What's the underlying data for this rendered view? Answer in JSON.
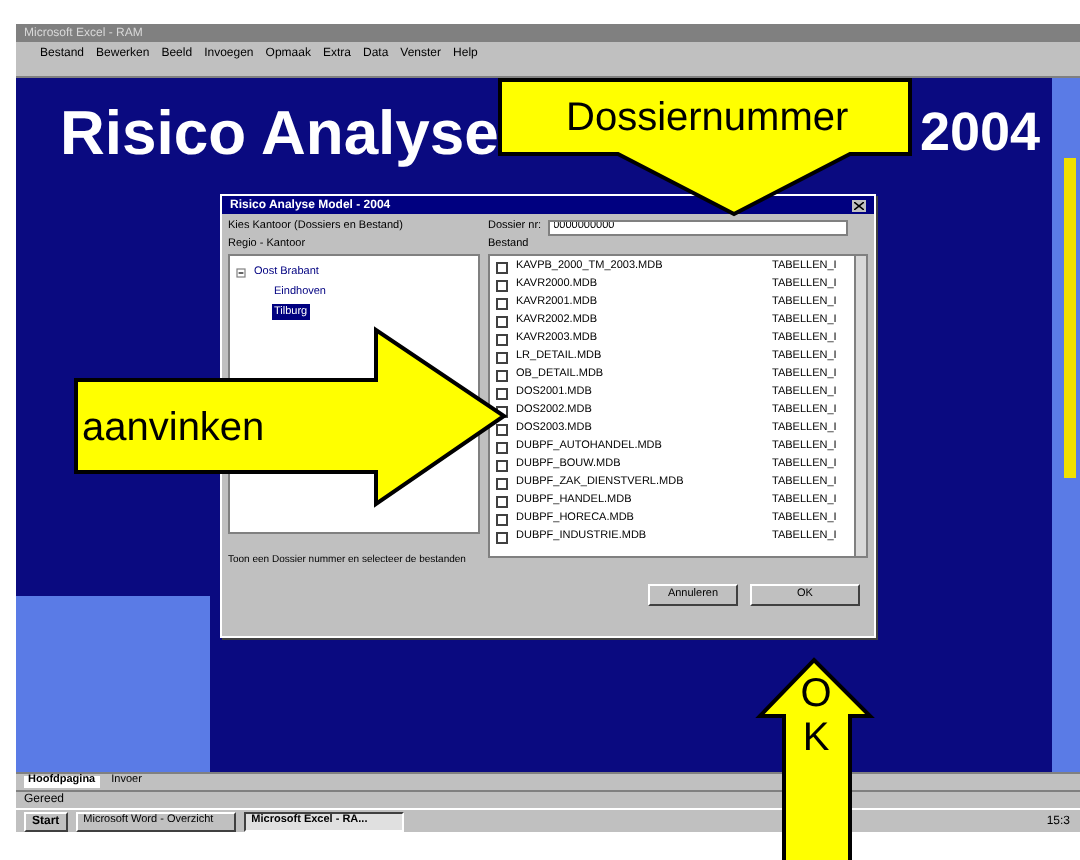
{
  "window": {
    "title": "Microsoft Excel - RAM"
  },
  "menu": [
    "Bestand",
    "Bewerken",
    "Beeld",
    "Invoegen",
    "Opmaak",
    "Extra",
    "Data",
    "Venster",
    "Help"
  ],
  "slide": {
    "title_start": "Risico Analyse",
    "title_end": "2004"
  },
  "dialog": {
    "title": "Risico Analyse Model - 2004",
    "kantoor_label": "Kies Kantoor (Dossiers en Bestand)",
    "regio_label": "Regio - Kantoor",
    "tree": [
      {
        "label": "Oost Brabant",
        "expanded": true,
        "selected": false,
        "children": [
          {
            "label": "Eindhoven",
            "selected": false
          },
          {
            "label": "Tilburg",
            "selected": true
          }
        ]
      }
    ],
    "dossier_label": "Dossier nr:",
    "dossier_value": "0000000000",
    "bestand_label": "Bestand",
    "files": [
      {
        "name": "KAVPB_2000_TM_2003.MDB",
        "type": "TABELLEN_I",
        "checked": false
      },
      {
        "name": "KAVR2000.MDB",
        "type": "TABELLEN_I",
        "checked": false
      },
      {
        "name": "KAVR2001.MDB",
        "type": "TABELLEN_I",
        "checked": false
      },
      {
        "name": "KAVR2002.MDB",
        "type": "TABELLEN_I",
        "checked": false
      },
      {
        "name": "KAVR2003.MDB",
        "type": "TABELLEN_I",
        "checked": false
      },
      {
        "name": "LR_DETAIL.MDB",
        "type": "TABELLEN_I",
        "checked": false
      },
      {
        "name": "OB_DETAIL.MDB",
        "type": "TABELLEN_I",
        "checked": false
      },
      {
        "name": "DOS2001.MDB",
        "type": "TABELLEN_I",
        "checked": false
      },
      {
        "name": "DOS2002.MDB",
        "type": "TABELLEN_I",
        "checked": false
      },
      {
        "name": "DOS2003.MDB",
        "type": "TABELLEN_I",
        "checked": false
      },
      {
        "name": "DUBPF_AUTOHANDEL.MDB",
        "type": "TABELLEN_I",
        "checked": false
      },
      {
        "name": "DUBPF_BOUW.MDB",
        "type": "TABELLEN_I",
        "checked": false
      },
      {
        "name": "DUBPF_ZAK_DIENSTVERL.MDB",
        "type": "TABELLEN_I",
        "checked": false
      },
      {
        "name": "DUBPF_HANDEL.MDB",
        "type": "TABELLEN_I",
        "checked": false
      },
      {
        "name": "DUBPF_HORECA.MDB",
        "type": "TABELLEN_I",
        "checked": false
      },
      {
        "name": "DUBPF_INDUSTRIE.MDB",
        "type": "TABELLEN_I",
        "checked": false
      }
    ],
    "hint": "Toon een Dossier nummer en selecteer de bestanden",
    "buttons": [
      "Annuleren",
      "OK"
    ]
  },
  "sheet_tabs": [
    {
      "label": "Hoofdpagina",
      "selected": true
    },
    {
      "label": "Invoer",
      "selected": false
    }
  ],
  "status_bar": "Gereed",
  "taskbar": {
    "start": "Start",
    "tasks": [
      {
        "label": "Microsoft Word - Overzicht",
        "selected": false
      },
      {
        "label": "Microsoft Excel - RA...",
        "selected": true
      }
    ],
    "clock": "15:3"
  },
  "callouts": [
    {
      "kind": "down",
      "text": "Dossiernummer"
    },
    {
      "kind": "right",
      "text": "aanvinken"
    },
    {
      "kind": "up",
      "text": "O K"
    }
  ]
}
